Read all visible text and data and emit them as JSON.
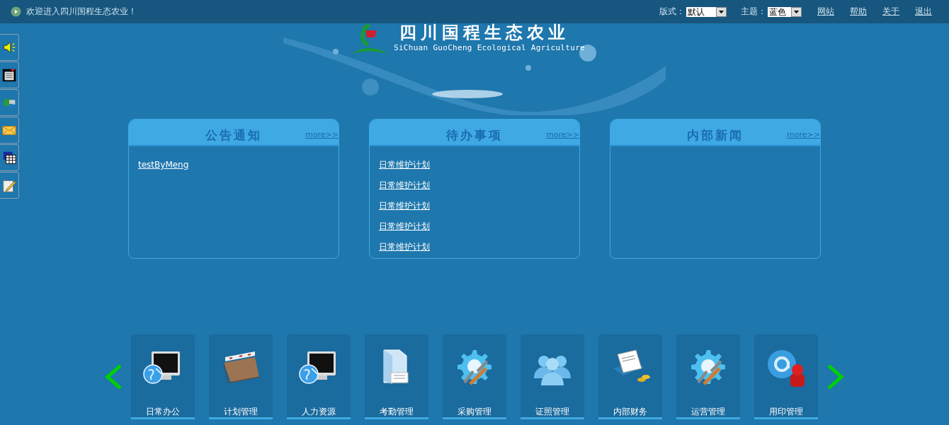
{
  "top_bar": {
    "welcome": "欢迎进入四川国程生态农业！",
    "selects": [
      {
        "label": "版式：",
        "value": "默认"
      },
      {
        "label": "主题：",
        "value": "蓝色"
      }
    ],
    "links": [
      "网站",
      "帮助",
      "关于",
      "退出"
    ]
  },
  "logo": {
    "title": "四川国程生态农业",
    "subtitle": "SiChuan GuoCheng Ecological Agriculture"
  },
  "panels": [
    {
      "title": "公告通知",
      "more": "more>>",
      "items": [
        "testByMeng"
      ]
    },
    {
      "title": "待办事项",
      "more": "more>>",
      "items": [
        "日常维护计划",
        "日常维护计划",
        "日常维护计划",
        "日常维护计划",
        "日常维护计划"
      ]
    },
    {
      "title": "内部新闻",
      "more": "more>>"
    }
  ],
  "modules": [
    "日常办公",
    "计划管理",
    "人力资源",
    "考勤管理",
    "采购管理",
    "证照管理",
    "内部财务",
    "运营管理",
    "用印管理"
  ]
}
